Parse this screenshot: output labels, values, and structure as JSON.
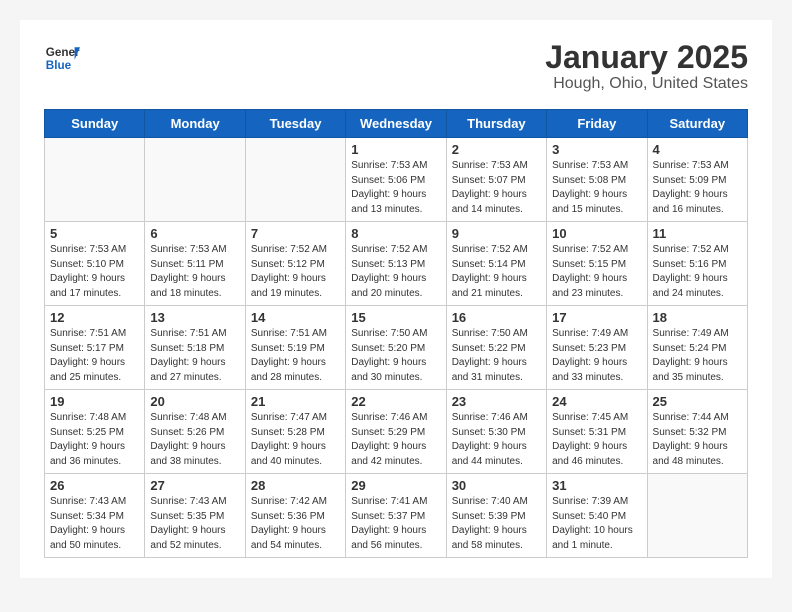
{
  "logo": {
    "general": "General",
    "blue": "Blue"
  },
  "header": {
    "month": "January 2025",
    "location": "Hough, Ohio, United States"
  },
  "weekdays": [
    "Sunday",
    "Monday",
    "Tuesday",
    "Wednesday",
    "Thursday",
    "Friday",
    "Saturday"
  ],
  "weeks": [
    [
      {
        "day": "",
        "empty": true
      },
      {
        "day": "",
        "empty": true
      },
      {
        "day": "",
        "empty": true
      },
      {
        "day": "1",
        "sunrise": "7:53 AM",
        "sunset": "5:06 PM",
        "daylight": "9 hours and 13 minutes."
      },
      {
        "day": "2",
        "sunrise": "7:53 AM",
        "sunset": "5:07 PM",
        "daylight": "9 hours and 14 minutes."
      },
      {
        "day": "3",
        "sunrise": "7:53 AM",
        "sunset": "5:08 PM",
        "daylight": "9 hours and 15 minutes."
      },
      {
        "day": "4",
        "sunrise": "7:53 AM",
        "sunset": "5:09 PM",
        "daylight": "9 hours and 16 minutes."
      }
    ],
    [
      {
        "day": "5",
        "sunrise": "7:53 AM",
        "sunset": "5:10 PM",
        "daylight": "9 hours and 17 minutes."
      },
      {
        "day": "6",
        "sunrise": "7:53 AM",
        "sunset": "5:11 PM",
        "daylight": "9 hours and 18 minutes."
      },
      {
        "day": "7",
        "sunrise": "7:52 AM",
        "sunset": "5:12 PM",
        "daylight": "9 hours and 19 minutes."
      },
      {
        "day": "8",
        "sunrise": "7:52 AM",
        "sunset": "5:13 PM",
        "daylight": "9 hours and 20 minutes."
      },
      {
        "day": "9",
        "sunrise": "7:52 AM",
        "sunset": "5:14 PM",
        "daylight": "9 hours and 21 minutes."
      },
      {
        "day": "10",
        "sunrise": "7:52 AM",
        "sunset": "5:15 PM",
        "daylight": "9 hours and 23 minutes."
      },
      {
        "day": "11",
        "sunrise": "7:52 AM",
        "sunset": "5:16 PM",
        "daylight": "9 hours and 24 minutes."
      }
    ],
    [
      {
        "day": "12",
        "sunrise": "7:51 AM",
        "sunset": "5:17 PM",
        "daylight": "9 hours and 25 minutes."
      },
      {
        "day": "13",
        "sunrise": "7:51 AM",
        "sunset": "5:18 PM",
        "daylight": "9 hours and 27 minutes."
      },
      {
        "day": "14",
        "sunrise": "7:51 AM",
        "sunset": "5:19 PM",
        "daylight": "9 hours and 28 minutes."
      },
      {
        "day": "15",
        "sunrise": "7:50 AM",
        "sunset": "5:20 PM",
        "daylight": "9 hours and 30 minutes."
      },
      {
        "day": "16",
        "sunrise": "7:50 AM",
        "sunset": "5:22 PM",
        "daylight": "9 hours and 31 minutes."
      },
      {
        "day": "17",
        "sunrise": "7:49 AM",
        "sunset": "5:23 PM",
        "daylight": "9 hours and 33 minutes."
      },
      {
        "day": "18",
        "sunrise": "7:49 AM",
        "sunset": "5:24 PM",
        "daylight": "9 hours and 35 minutes."
      }
    ],
    [
      {
        "day": "19",
        "sunrise": "7:48 AM",
        "sunset": "5:25 PM",
        "daylight": "9 hours and 36 minutes."
      },
      {
        "day": "20",
        "sunrise": "7:48 AM",
        "sunset": "5:26 PM",
        "daylight": "9 hours and 38 minutes."
      },
      {
        "day": "21",
        "sunrise": "7:47 AM",
        "sunset": "5:28 PM",
        "daylight": "9 hours and 40 minutes."
      },
      {
        "day": "22",
        "sunrise": "7:46 AM",
        "sunset": "5:29 PM",
        "daylight": "9 hours and 42 minutes."
      },
      {
        "day": "23",
        "sunrise": "7:46 AM",
        "sunset": "5:30 PM",
        "daylight": "9 hours and 44 minutes."
      },
      {
        "day": "24",
        "sunrise": "7:45 AM",
        "sunset": "5:31 PM",
        "daylight": "9 hours and 46 minutes."
      },
      {
        "day": "25",
        "sunrise": "7:44 AM",
        "sunset": "5:32 PM",
        "daylight": "9 hours and 48 minutes."
      }
    ],
    [
      {
        "day": "26",
        "sunrise": "7:43 AM",
        "sunset": "5:34 PM",
        "daylight": "9 hours and 50 minutes."
      },
      {
        "day": "27",
        "sunrise": "7:43 AM",
        "sunset": "5:35 PM",
        "daylight": "9 hours and 52 minutes."
      },
      {
        "day": "28",
        "sunrise": "7:42 AM",
        "sunset": "5:36 PM",
        "daylight": "9 hours and 54 minutes."
      },
      {
        "day": "29",
        "sunrise": "7:41 AM",
        "sunset": "5:37 PM",
        "daylight": "9 hours and 56 minutes."
      },
      {
        "day": "30",
        "sunrise": "7:40 AM",
        "sunset": "5:39 PM",
        "daylight": "9 hours and 58 minutes."
      },
      {
        "day": "31",
        "sunrise": "7:39 AM",
        "sunset": "5:40 PM",
        "daylight": "10 hours and 1 minute."
      },
      {
        "day": "",
        "empty": true
      }
    ]
  ]
}
